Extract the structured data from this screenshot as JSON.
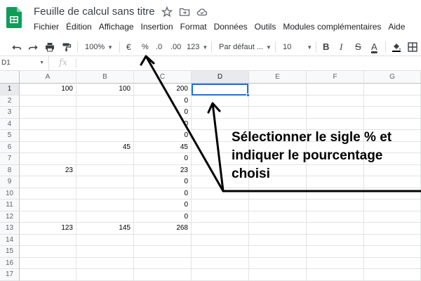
{
  "app": {
    "doc_title": "Feuille de calcul sans titre",
    "logo_icon": "sheets-logo-icon",
    "title_icons": [
      "star-icon",
      "move-folder-icon",
      "cloud-status-icon"
    ],
    "brand_color": "#0f9d58"
  },
  "menu": [
    "Fichier",
    "Édition",
    "Affichage",
    "Insertion",
    "Format",
    "Données",
    "Outils",
    "Modules complémentaires",
    "Aide"
  ],
  "toolbar": {
    "undo_icon": "undo-icon",
    "redo_icon": "redo-icon",
    "print_icon": "print-icon",
    "paint_format_icon": "paint-format-icon",
    "zoom": "100%",
    "currency": "€",
    "percent": "%",
    "decrease_decimals": ".0",
    "increase_decimals": ".00",
    "more_formats": "123",
    "font": "Par défaut ...",
    "font_size": "10",
    "bold": "B",
    "italic": "I",
    "strikethrough": "S",
    "text_color": "A"
  },
  "formula_bar": {
    "name_box": "D1",
    "fx": "fx",
    "value": ""
  },
  "grid": {
    "columns": [
      "A",
      "B",
      "C",
      "D",
      "E",
      "F",
      "G"
    ],
    "selected_column": "D",
    "selected_row": "1",
    "rows": [
      {
        "n": "1",
        "A": "100",
        "B": "100",
        "C": "200"
      },
      {
        "n": "2",
        "A": "",
        "B": "",
        "C": "0"
      },
      {
        "n": "3",
        "A": "",
        "B": "",
        "C": "0"
      },
      {
        "n": "4",
        "A": "",
        "B": "",
        "C": "0"
      },
      {
        "n": "5",
        "A": "",
        "B": "",
        "C": "0"
      },
      {
        "n": "6",
        "A": "",
        "B": "45",
        "C": "45"
      },
      {
        "n": "7",
        "A": "",
        "B": "",
        "C": "0"
      },
      {
        "n": "8",
        "A": "23",
        "B": "",
        "C": "23"
      },
      {
        "n": "9",
        "A": "",
        "B": "",
        "C": "0"
      },
      {
        "n": "10",
        "A": "",
        "B": "",
        "C": "0"
      },
      {
        "n": "11",
        "A": "",
        "B": "",
        "C": "0"
      },
      {
        "n": "12",
        "A": "",
        "B": "",
        "C": "0"
      },
      {
        "n": "13",
        "A": "123",
        "B": "145",
        "C": "268"
      },
      {
        "n": "14",
        "A": "",
        "B": "",
        "C": ""
      },
      {
        "n": "15",
        "A": "",
        "B": "",
        "C": ""
      },
      {
        "n": "16",
        "A": "",
        "B": "",
        "C": ""
      },
      {
        "n": "17",
        "A": "",
        "B": "",
        "C": ""
      }
    ]
  },
  "annotation": {
    "lines": [
      "Sélectionner le sigle % et",
      "indiquer le pourcentage",
      "choisi"
    ],
    "color": "#000000"
  },
  "colors": {
    "selection": "#1a73e8",
    "header_bg": "#f8f9fa",
    "grid_line": "#e2e3e3"
  }
}
